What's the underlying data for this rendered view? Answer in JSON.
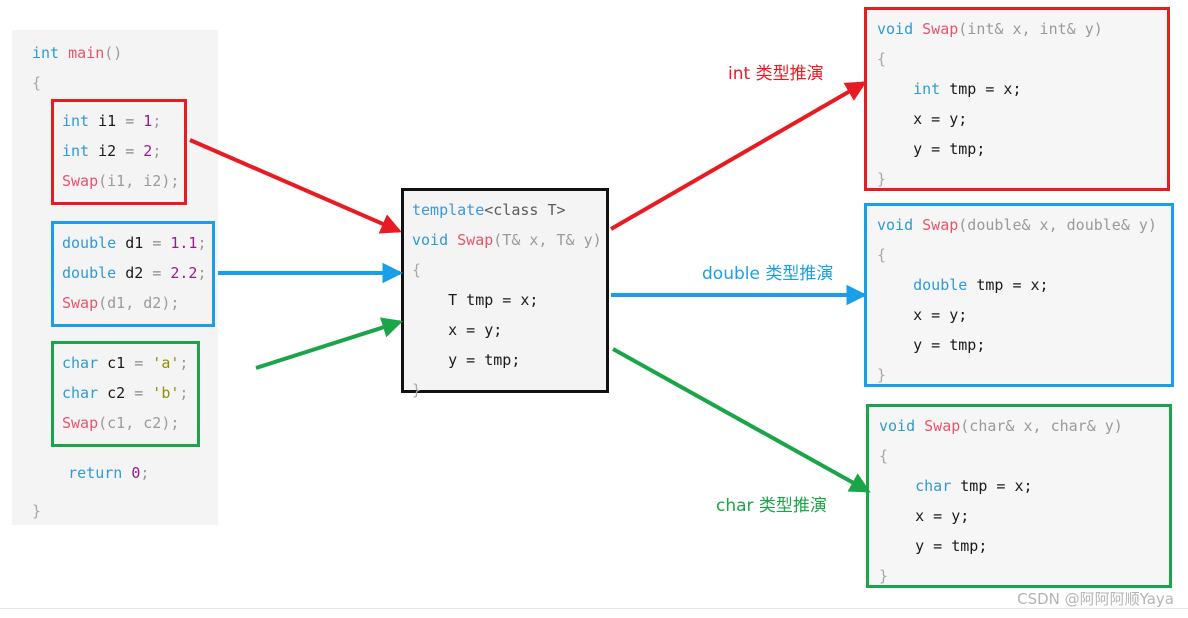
{
  "colors": {
    "red": "#e81b23",
    "blue": "#1b9ee8",
    "green": "#1aa548",
    "black": "#111111",
    "panel_bg": "#f4f4f4",
    "watermark": "#b4b4b4"
  },
  "main_panel": {
    "header_lines": [
      "int main()",
      "{"
    ],
    "footer_lines": [
      "return 0;",
      "}"
    ],
    "header": {
      "kw": "int",
      "fn": "main",
      "parens": "()",
      "open_brace": "{"
    },
    "footer": {
      "kw": "return",
      "num": "0",
      "semi": ";",
      "close_brace": "}"
    }
  },
  "groups": [
    {
      "id": "int",
      "border_color": "#e81b23",
      "lines": [
        {
          "kw": "int",
          "name": " i1 ",
          "op": "=",
          "num": " 1",
          "semi": ";"
        },
        {
          "kw": "int",
          "name": " i2 ",
          "op": "=",
          "num": " 2",
          "semi": ";"
        }
      ],
      "call": {
        "fn": "Swap",
        "args": "(i1, i2);"
      },
      "text": "int i1 = 1;\nint i2 = 2;\nSwap(i1, i2);"
    },
    {
      "id": "double",
      "border_color": "#1b9ee8",
      "lines": [
        {
          "kw": "double",
          "name": " d1 ",
          "op": "=",
          "num": " 1.1",
          "semi": ";"
        },
        {
          "kw": "double",
          "name": " d2 ",
          "op": "=",
          "num": " 2.2",
          "semi": ";"
        }
      ],
      "call": {
        "fn": "Swap",
        "args": "(d1, d2);"
      },
      "text": "double d1 = 1.1;\ndouble d2 = 2.2;\nSwap(d1, d2);"
    },
    {
      "id": "char",
      "border_color": "#1aa548",
      "lines": [
        {
          "kw": "char",
          "name": " c1 ",
          "op": "=",
          "chr": " 'a'",
          "semi": ";"
        },
        {
          "kw": "char",
          "name": " c2 ",
          "op": "=",
          "chr": " 'b'",
          "semi": ";"
        }
      ],
      "call": {
        "fn": "Swap",
        "args": "(c1, c2);"
      },
      "text": "char c1 = 'a';\nchar c2 = 'b';\nSwap(c1, c2);"
    }
  ],
  "template_box": {
    "border_color": "#111111",
    "decl_kw": "template",
    "decl_args": "<class T>",
    "ret_kw": "void",
    "fn": "Swap",
    "params": "(T& x, T& y)",
    "open_brace": "{",
    "body": [
      "T tmp = x;",
      "x = y;",
      "y = tmp;"
    ],
    "close_brace": "}",
    "text": "template<class T>\nvoid Swap(T& x, T& y)\n{\n    T tmp = x;\n    x = y;\n    y = tmp;\n}"
  },
  "instances": [
    {
      "id": "int",
      "border_color": "#e81b23",
      "ret_kw": "void",
      "fn": "Swap",
      "params": "(int& x, int& y)",
      "param_type": "int",
      "open_brace": "{",
      "body_decl_kw": "int",
      "body_decl_rest": " tmp = x;",
      "body": [
        "int tmp = x;",
        "x = y;",
        "y = tmp;"
      ],
      "close_brace": "}",
      "text": "void Swap(int& x, int& y)\n{\n    int tmp = x;\n    x = y;\n    y = tmp;\n}"
    },
    {
      "id": "double",
      "border_color": "#1b9ee8",
      "ret_kw": "void",
      "fn": "Swap",
      "params": "(double& x, double& y)",
      "param_type": "double",
      "open_brace": "{",
      "body_decl_kw": "double",
      "body_decl_rest": " tmp = x;",
      "body": [
        "double tmp = x;",
        "x = y;",
        "y = tmp;"
      ],
      "close_brace": "}",
      "text": "void Swap(double& x, double& y)\n{\n    double tmp = x;\n    x = y;\n    y = tmp;\n}"
    },
    {
      "id": "char",
      "border_color": "#1aa548",
      "ret_kw": "void",
      "fn": "Swap",
      "params": "(char& x, char& y)",
      "param_type": "char",
      "open_brace": "{",
      "body_decl_kw": "char",
      "body_decl_rest": " tmp = x;",
      "body": [
        "char tmp = x;",
        "x = y;",
        "y = tmp;"
      ],
      "close_brace": "}",
      "text": "void Swap(char& x, char& y)\n{\n    char tmp = x;\n    x = y;\n    y = tmp;\n}"
    }
  ],
  "arrow_labels": {
    "int": "int 类型推演",
    "double": "double 类型推演",
    "char": "char 类型推演"
  },
  "watermark": "CSDN @阿阿阿顺Yaya"
}
